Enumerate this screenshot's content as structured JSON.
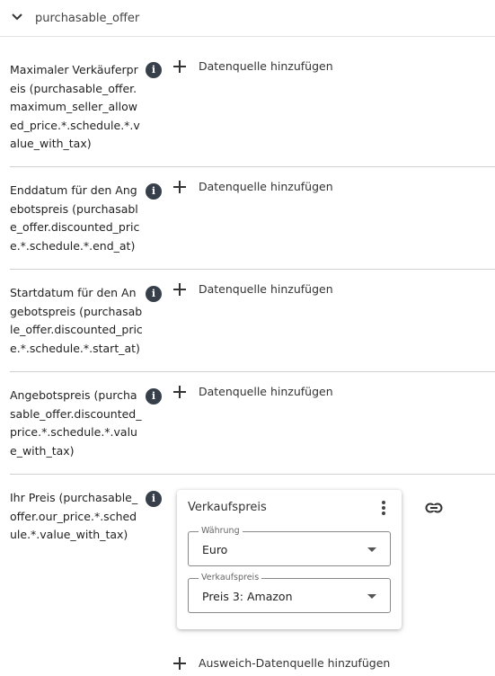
{
  "section": {
    "title": "purchasable_offer"
  },
  "fields": [
    {
      "label": "Maximaler Verkäuferpreis (purchasable_offer.maximum_seller_allowed_price.*.schedule.*.value_with_tax)",
      "action": "Datenquelle hinzufügen"
    },
    {
      "label": "Enddatum für den Angebotspreis (purchasable_offer.discounted_price.*.schedule.*.end_at)",
      "action": "Datenquelle hinzufügen"
    },
    {
      "label": "Startdatum für den Angebotspreis (purchasable_offer.discounted_price.*.schedule.*.start_at)",
      "action": "Datenquelle hinzufügen"
    },
    {
      "label": "Angebotspreis (purchasable_offer.discounted_price.*.schedule.*.value_with_tax)",
      "action": "Datenquelle hinzufügen"
    },
    {
      "label": "Ihr Preis (purchasable_offer.our_price.*.schedule.*.value_with_tax)",
      "action": "Ausweich-Datenquelle hinzufügen"
    }
  ],
  "card": {
    "title": "Verkaufspreis",
    "selects": [
      {
        "legend": "Währung",
        "value": "Euro"
      },
      {
        "legend": "Verkaufspreis",
        "value": "Preis 3: Amazon"
      }
    ]
  },
  "icons": {
    "info": "info-icon",
    "add": "plus-icon",
    "menu": "more-vert-icon",
    "link": "link-icon",
    "collapse": "chevron-down-icon"
  }
}
